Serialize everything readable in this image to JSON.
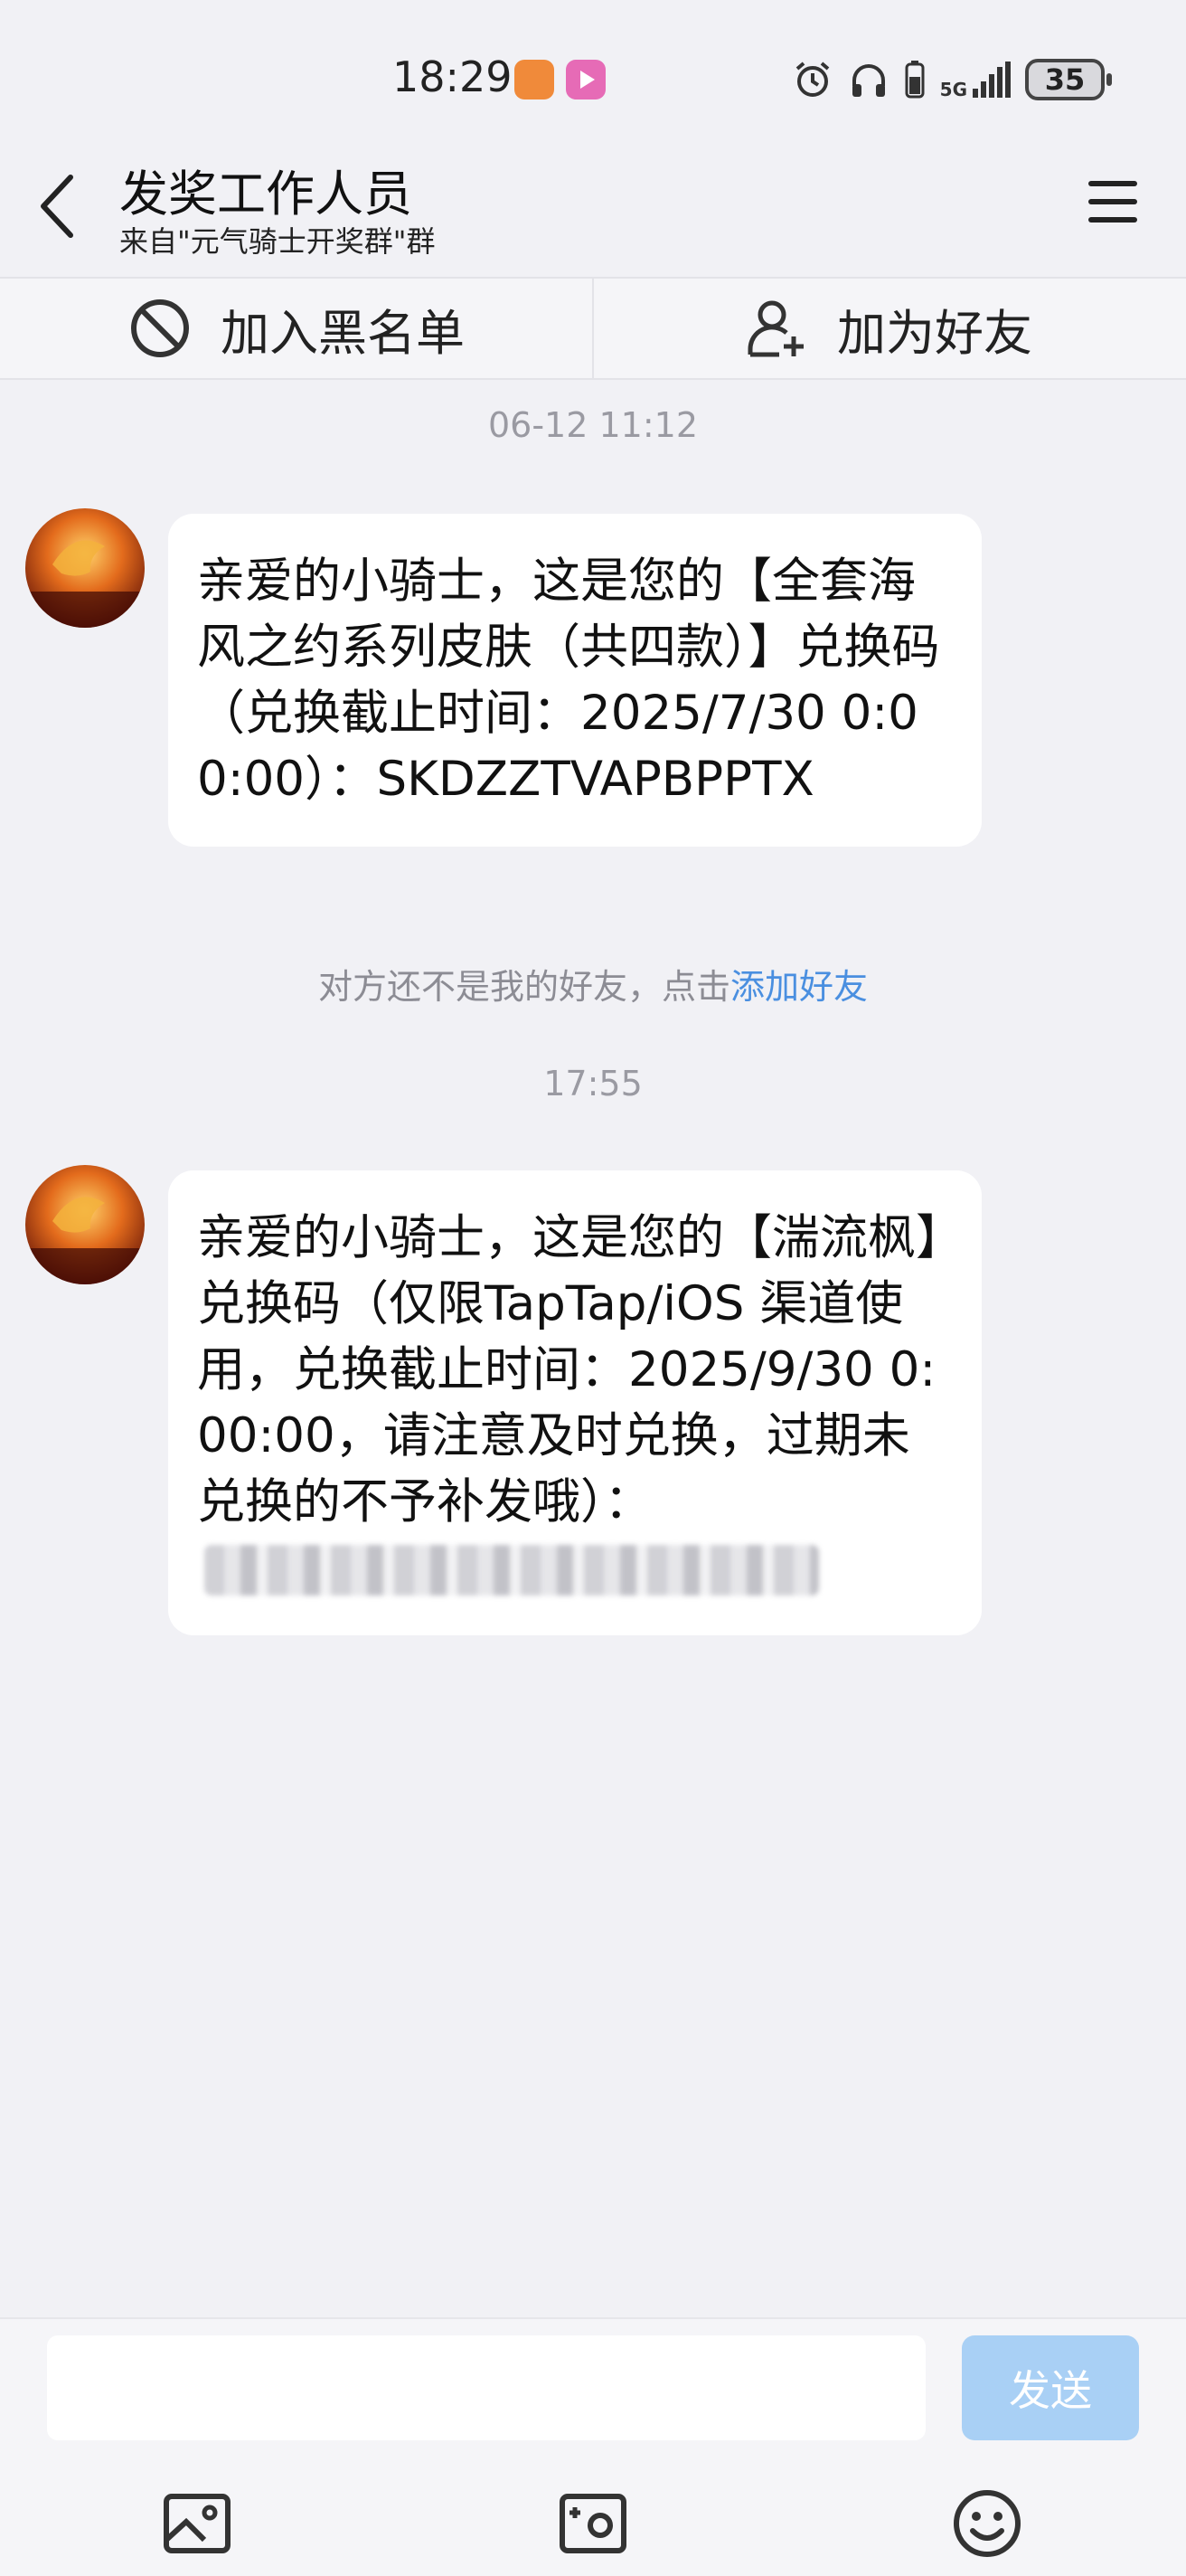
{
  "status_bar": {
    "time": "18:29",
    "network": "5G",
    "battery": "35",
    "icons": [
      "orange-app-icon",
      "video-app-icon",
      "alarm-icon",
      "headphones-icon",
      "phone-battery-icon",
      "signal-icon"
    ]
  },
  "header": {
    "title": "发奖工作人员",
    "subtitle": "来自\"元气骑士开奖群\"群",
    "icons": [
      "back-arrow-icon",
      "menu-icon"
    ]
  },
  "actions": {
    "block_label": "加入黑名单",
    "add_friend_label": "加为好友",
    "icons": [
      "block-icon",
      "add-user-icon"
    ]
  },
  "chat": {
    "timestamp_1": "06-12 11:12",
    "message_1": "亲爱的小骑士，这是您的【全套海风之约系列皮肤（共四款）】兑换码（兑换截止时间：2025/7/30 0:00:00）：SKDZZTVAPBPPTX",
    "notice_text": "对方还不是我的好友，点击",
    "notice_link": "添加好友",
    "timestamp_2": "17:55",
    "message_2": "亲爱的小骑士，这是您的【湍流枫】兑换码（仅限TapTap/iOS 渠道使用，兑换截止时间：2025/9/30 0:00:00，请注意及时兑换，过期未兑换的不予补发哦）："
  },
  "input": {
    "placeholder": "",
    "send_label": "发送",
    "icons": [
      "image-icon",
      "camera-icon",
      "emoji-icon"
    ]
  }
}
